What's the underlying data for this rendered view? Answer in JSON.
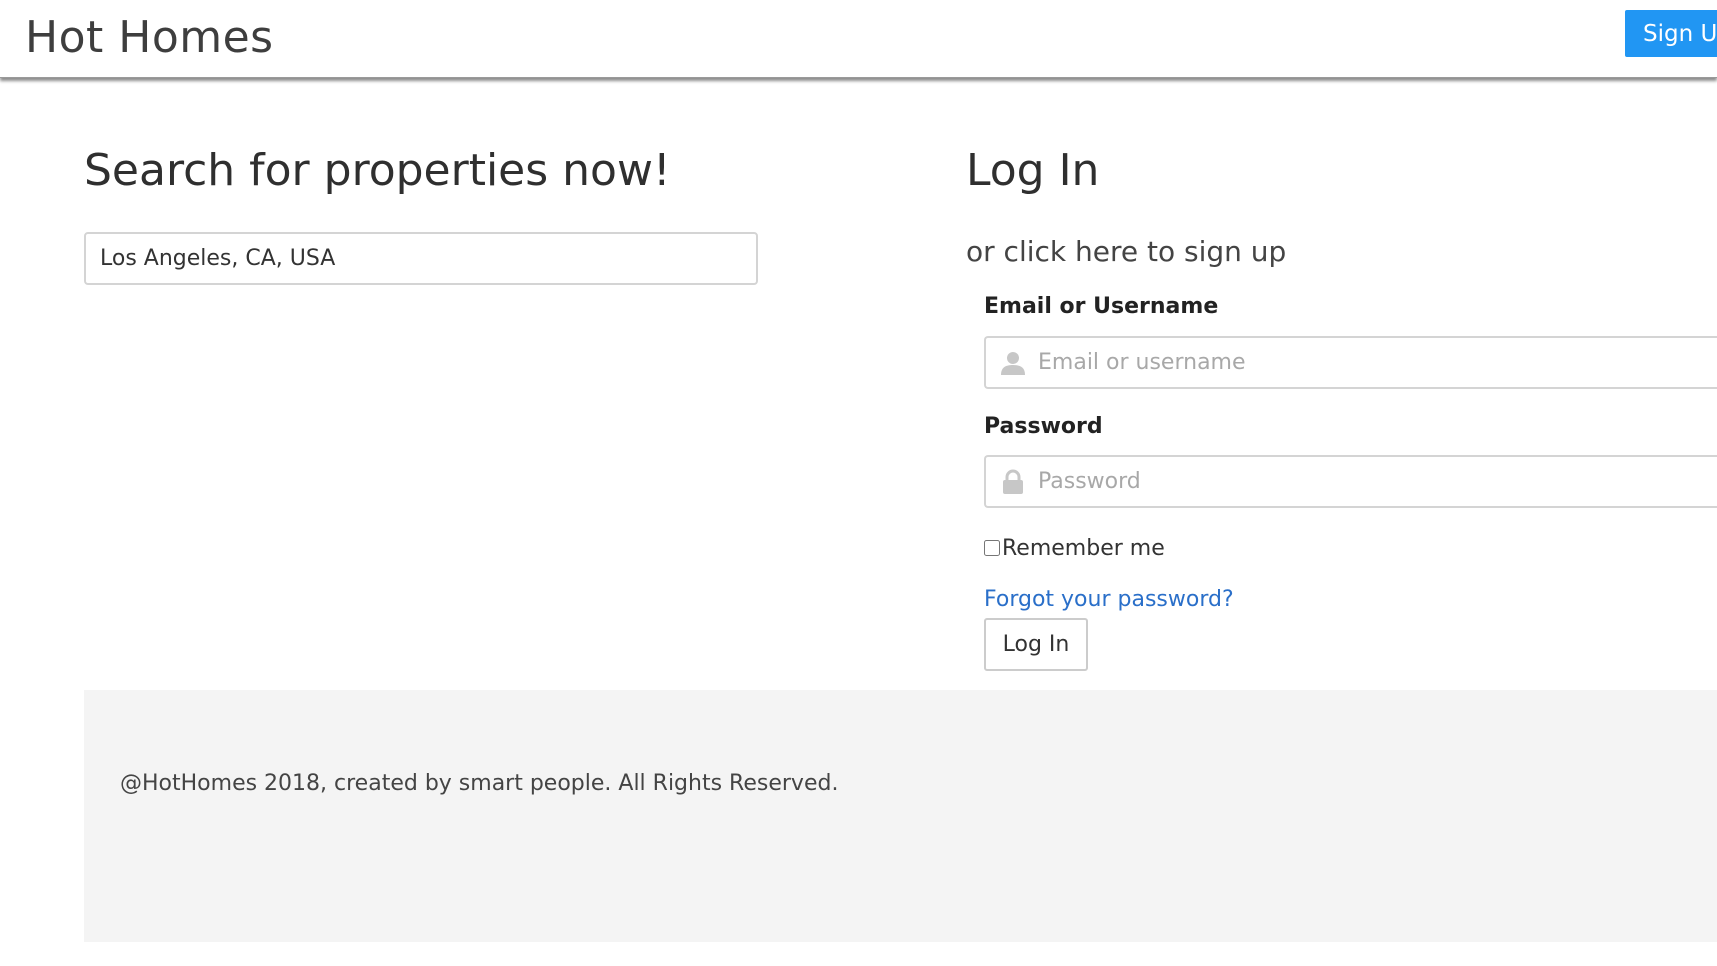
{
  "header": {
    "brand": "Hot Homes",
    "signup_label": "Sign Up"
  },
  "search": {
    "title": "Search for properties now!",
    "location_value": "Los Angeles, CA, USA"
  },
  "login": {
    "title": "Log In",
    "signup_hint": "or click here to sign up",
    "email_label": "Email or Username",
    "email_placeholder": "Email or username",
    "email_icon": "user-icon",
    "password_label": "Password",
    "password_placeholder": "Password",
    "password_icon": "lock-icon",
    "remember_label": "Remember me",
    "remember_checked": false,
    "forgot_label": "Forgot your password?",
    "submit_label": "Log In"
  },
  "footer": {
    "text": "@HotHomes 2018, created by smart people. All Rights Reserved."
  },
  "colors": {
    "accent": "#2196f3",
    "link": "#2a6fc9",
    "footer_bg": "#f4f4f4"
  }
}
